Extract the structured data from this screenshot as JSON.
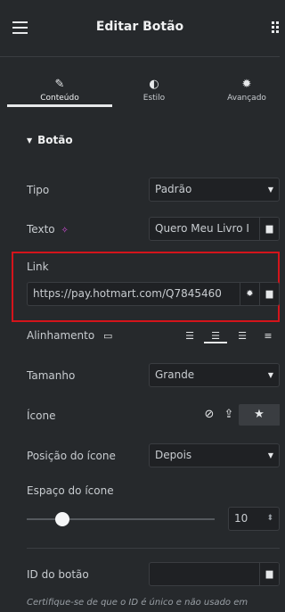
{
  "header": {
    "title": "Editar Botão",
    "menu_icon": "hamburger-icon",
    "apps_icon": "apps-grid-icon"
  },
  "tabs": [
    {
      "label": "Conteúdo",
      "icon": "pencil-icon",
      "active": true
    },
    {
      "label": "Estilo",
      "icon": "half-circle-icon",
      "active": false
    },
    {
      "label": "Avançado",
      "icon": "gear-icon",
      "active": false
    }
  ],
  "section": {
    "label": "Botão"
  },
  "controls": {
    "tipo": {
      "label": "Tipo",
      "value": "Padrão"
    },
    "texto": {
      "label": "Texto",
      "value": "Quero Meu Livro I"
    },
    "link": {
      "label": "Link",
      "value": "https://pay.hotmart.com/Q7845460"
    },
    "alinhamento": {
      "label": "Alinhamento",
      "options": [
        "align-left-icon",
        "align-center-icon",
        "align-right-icon",
        "align-justify-icon"
      ],
      "selected": 1
    },
    "tamanho": {
      "label": "Tamanho",
      "value": "Grande"
    },
    "icone": {
      "label": "Ícone",
      "options": [
        "none-icon",
        "upload-icon",
        "library-icon"
      ]
    },
    "posicao_icone": {
      "label": "Posição do ícone",
      "value": "Depois"
    },
    "espaco_icone": {
      "label": "Espaço do ícone",
      "value": "10"
    },
    "id_botao": {
      "label": "ID do botão",
      "value": ""
    }
  },
  "note": "Certifique-se de que o ID é único e não usado em",
  "colors": {
    "background": "#26292c",
    "highlight": "#d4141b"
  }
}
